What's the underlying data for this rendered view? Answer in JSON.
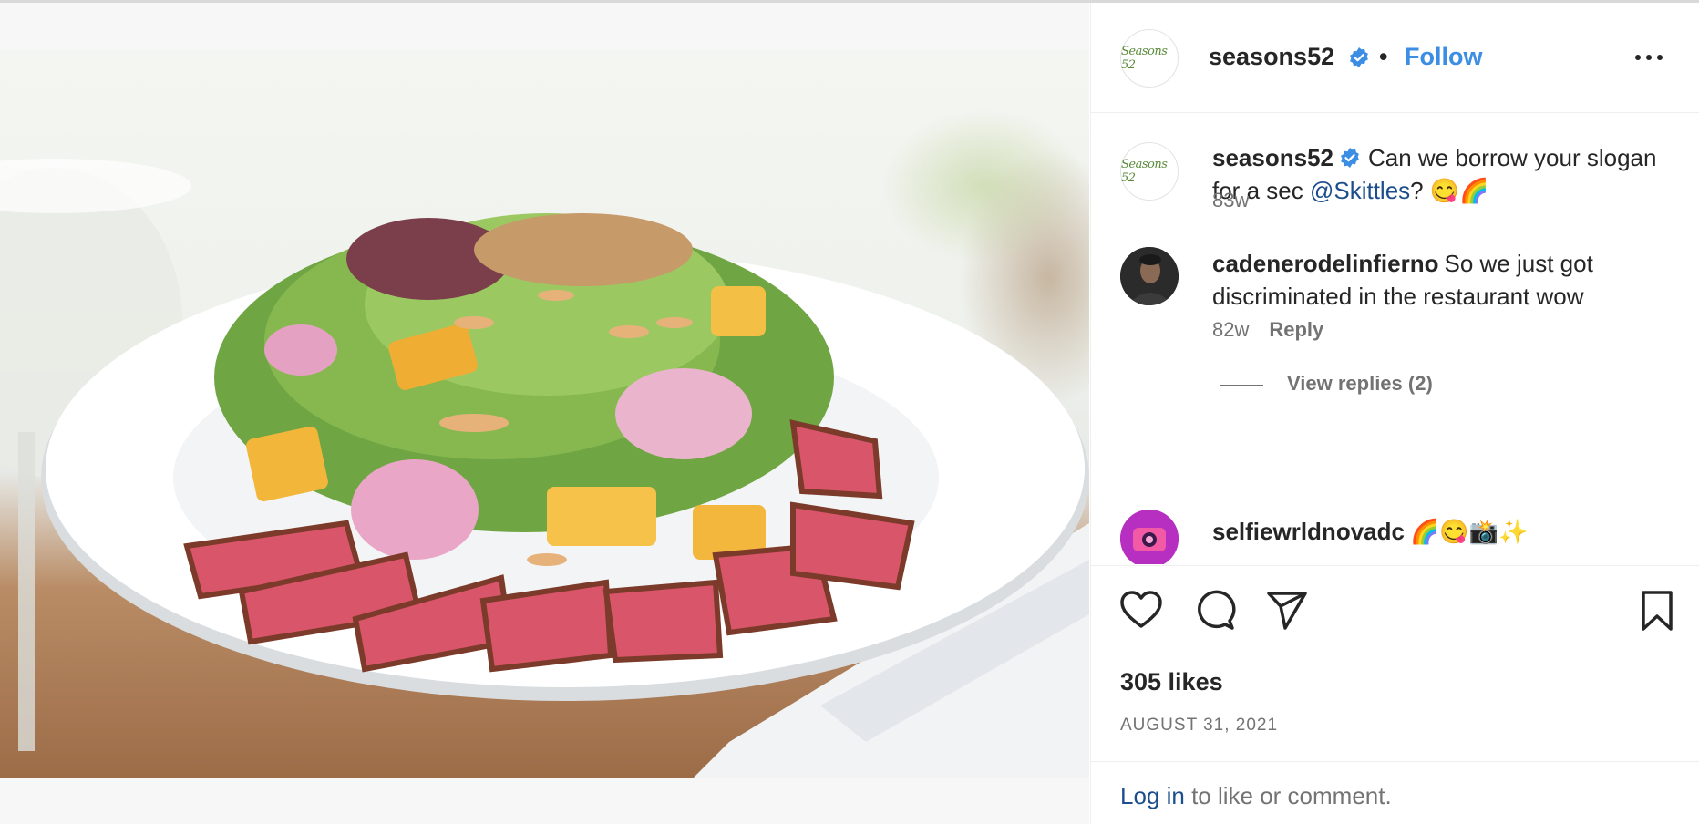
{
  "post": {
    "author": "seasons52",
    "logo_text": "Seasons 52",
    "follow_label": "Follow",
    "separator": "•"
  },
  "comments": [
    {
      "username": "seasons52",
      "text_before": "Can we borrow your slogan for a sec",
      "mention": "@Skittles",
      "text_after": "? 😋🌈",
      "time": "83w"
    },
    {
      "username": "cadenerodelinfierno",
      "text": "So we just got discriminated in the restaurant wow",
      "time": "82w",
      "reply_label": "Reply",
      "view_replies": "View replies (2)"
    },
    {
      "username": "selfiewrldnovadc",
      "text": "🌈😋📸✨"
    }
  ],
  "actions": {
    "likes": "305 likes",
    "date": "AUGUST 31, 2021"
  },
  "login": {
    "link": "Log in",
    "rest": " to like or comment."
  },
  "colors": {
    "accent_blue": "#3b8ee3",
    "mention_blue": "#1d4e8c",
    "muted": "#737373"
  },
  "icons": [
    "verified-badge-icon",
    "more-options-icon",
    "heart-icon",
    "comment-icon",
    "share-icon",
    "bookmark-icon"
  ]
}
